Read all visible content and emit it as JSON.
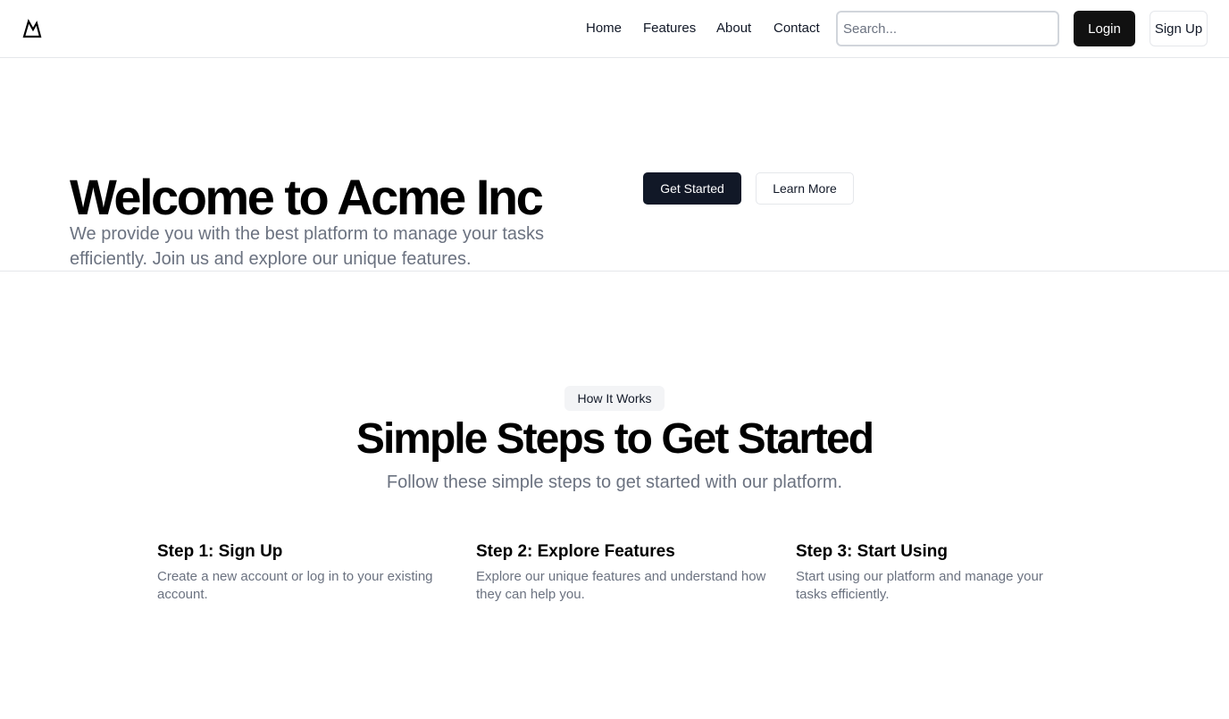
{
  "header": {
    "logo_icon": "mountain-icon",
    "nav": [
      {
        "label": "Home"
      },
      {
        "label": "Features"
      },
      {
        "label": "About"
      },
      {
        "label": "Contact"
      }
    ],
    "search": {
      "placeholder": "Search...",
      "value": ""
    },
    "login_label": "Login",
    "signup_label": "Sign Up"
  },
  "hero": {
    "title": "Welcome to Acme Inc",
    "subtitle": "We provide you with the best platform to manage your tasks efficiently. Join us and explore our unique features.",
    "primary_label": "Get Started",
    "secondary_label": "Learn More"
  },
  "how_it_works": {
    "badge": "How It Works",
    "title": "Simple Steps to Get Started",
    "subtitle": "Follow these simple steps to get started with our platform.",
    "steps": [
      {
        "title": "Step 1: Sign Up",
        "description": "Create a new account or log in to your existing account."
      },
      {
        "title": "Step 2: Explore Features",
        "description": "Explore our unique features and understand how they can help you."
      },
      {
        "title": "Step 3: Start Using",
        "description": "Start using our platform and manage your tasks efficiently."
      }
    ]
  },
  "colors": {
    "primary_button": "#111827",
    "login_button": "#111111",
    "muted_text": "#6b7280",
    "border": "#e5e7eb",
    "badge_bg": "#f3f4f6"
  }
}
